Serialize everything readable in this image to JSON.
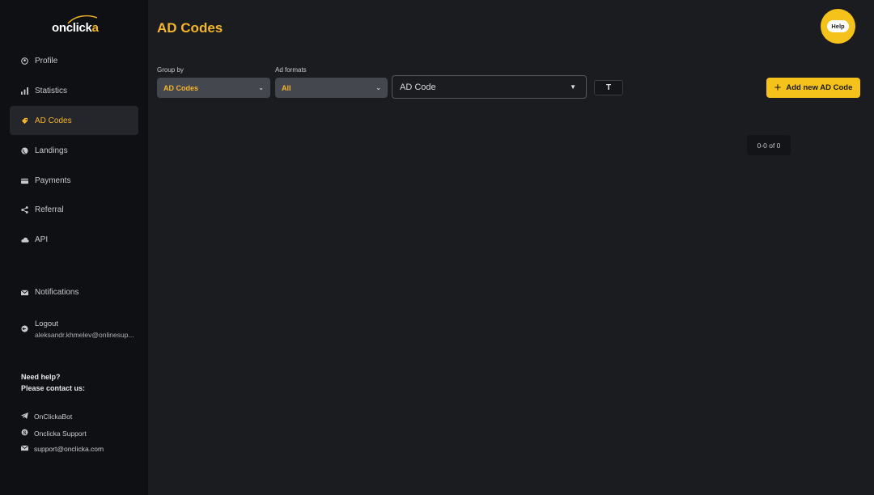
{
  "app": {
    "logo_text_main": "onclick",
    "logo_text_accent": "a"
  },
  "sidebar": {
    "items": [
      {
        "label": "Profile",
        "icon": "user-circle-icon"
      },
      {
        "label": "Statistics",
        "icon": "bar-chart-icon"
      },
      {
        "label": "AD Codes",
        "icon": "tag-icon",
        "active": true
      },
      {
        "label": "Landings",
        "icon": "globe-icon"
      },
      {
        "label": "Payments",
        "icon": "card-icon"
      },
      {
        "label": "Referral",
        "icon": "share-icon"
      },
      {
        "label": "API",
        "icon": "cloud-icon"
      },
      {
        "label": "Notifications",
        "icon": "mail-icon"
      }
    ],
    "logout": {
      "label": "Logout",
      "email": "aleksandr.khmelev@onlinesup..."
    },
    "help_line1": "Need help?",
    "help_line2": "Please contact us:",
    "contacts": [
      {
        "label": "OnClickaBot",
        "icon": "telegram-icon"
      },
      {
        "label": "Onclicka Support",
        "icon": "skype-icon"
      },
      {
        "label": "support@onclicka.com",
        "icon": "mail-icon"
      }
    ]
  },
  "header": {
    "title": "AD Codes",
    "help_label": "Help"
  },
  "filters": {
    "group_by_label": "Group by",
    "group_by_value": "AD Codes",
    "ad_formats_label": "Ad formats",
    "ad_formats_value": "All",
    "adcode_select_value": "AD Code",
    "filter_button_label": "T",
    "add_button_label": "Add new AD Code"
  },
  "pagination": {
    "text": "0-0 of 0"
  },
  "colors": {
    "accent": "#f5b52a",
    "button_yellow": "#f5c21b",
    "sidebar_bg": "#0f1013",
    "main_bg": "#1b1c20"
  }
}
